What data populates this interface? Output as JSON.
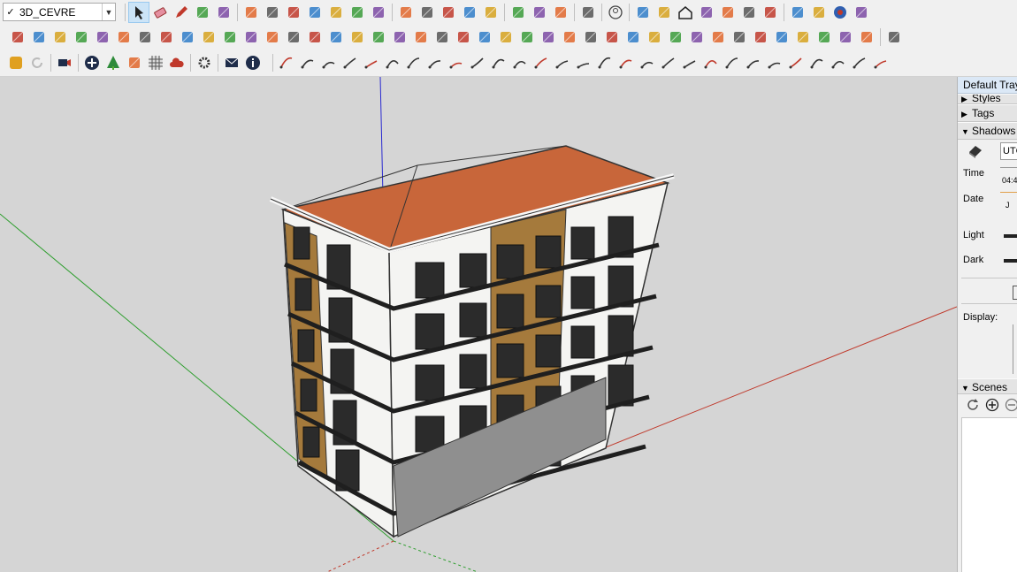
{
  "toolbar": {
    "tag_value": "3D_CEVRE",
    "tag_checked": "✓"
  },
  "tray": {
    "title": "Default Tray",
    "panels": {
      "styles": "Styles",
      "tags": "Tags",
      "shadows": "Shadows",
      "scenes": "Scenes"
    },
    "shadows": {
      "utc_value": "UTC",
      "time_label": "Time",
      "time_value": "04:4",
      "date_label": "Date",
      "date_value": "J",
      "light_label": "Light",
      "dark_label": "Dark",
      "display_label": "Display:"
    }
  },
  "colors": {
    "toolbar_bg": "#f0f0f0",
    "viewport_bg": "#d5d5d5",
    "roof": "#c8663a",
    "wall_white": "#f4f4f2",
    "wall_brown": "#a57a3c",
    "window_dark": "#2b2b2b",
    "balcony": "#3a3a3a",
    "axis_red": "#c0392b",
    "axis_green": "#2e9e2e",
    "axis_blue": "#2a2ad0"
  },
  "icons": {
    "row1": [
      "select-icon",
      "eraser-icon",
      "pencil-icon",
      "arc-icon",
      "shape-icon",
      "push-pull-icon",
      "follow-me-icon",
      "move-icon",
      "rotate-icon",
      "scale-icon",
      "tape-measure-icon",
      "text-icon",
      "paint-bucket-icon",
      "orbit-icon",
      "pan-icon",
      "zoom-icon",
      "zoom-extents-icon",
      "section-icon",
      "offset-icon",
      "layers-icon",
      "sandbox-icon",
      "account-icon",
      "iso-view-icon",
      "front-view-icon",
      "home-icon",
      "right-view-icon",
      "back-view-icon",
      "left-view-icon",
      "stack-icon",
      "stack-icon",
      "extension-icon",
      "globe-icon",
      "warehouse-icon"
    ],
    "row2": [
      "plugin-icon",
      "plugin-icon",
      "plugin-icon",
      "plugin-icon",
      "plugin-icon",
      "plugin-icon",
      "spiral-icon",
      "square-icon",
      "grid-icon",
      "flag-icon",
      "tube-icon",
      "pipe-icon",
      "bend-icon",
      "dots-icon",
      "cross-icon",
      "cross-icon",
      "cross-icon",
      "triangle-icon",
      "triangle-icon",
      "warning-icon",
      "curve-icon",
      "curve-icon",
      "curve-icon",
      "compass-icon",
      "barrel-icon",
      "undo-icon",
      "puzzle-icon",
      "copy-icon",
      "copy-icon",
      "shape-icon",
      "dots-icon",
      "frame-icon",
      "grid-icon",
      "grid-icon",
      "grid-icon",
      "cross-icon",
      "circle-icon",
      "grid-icon",
      "window-icon",
      "window-icon",
      "window-icon",
      "window-icon"
    ],
    "row3": [
      "logo-icon",
      "refresh-icon",
      "camera-icon",
      "add-icon",
      "tree-icon",
      "layers-icon",
      "checker-icon",
      "cloud-icon",
      "gear-icon",
      "mail-icon",
      "info-icon"
    ]
  }
}
